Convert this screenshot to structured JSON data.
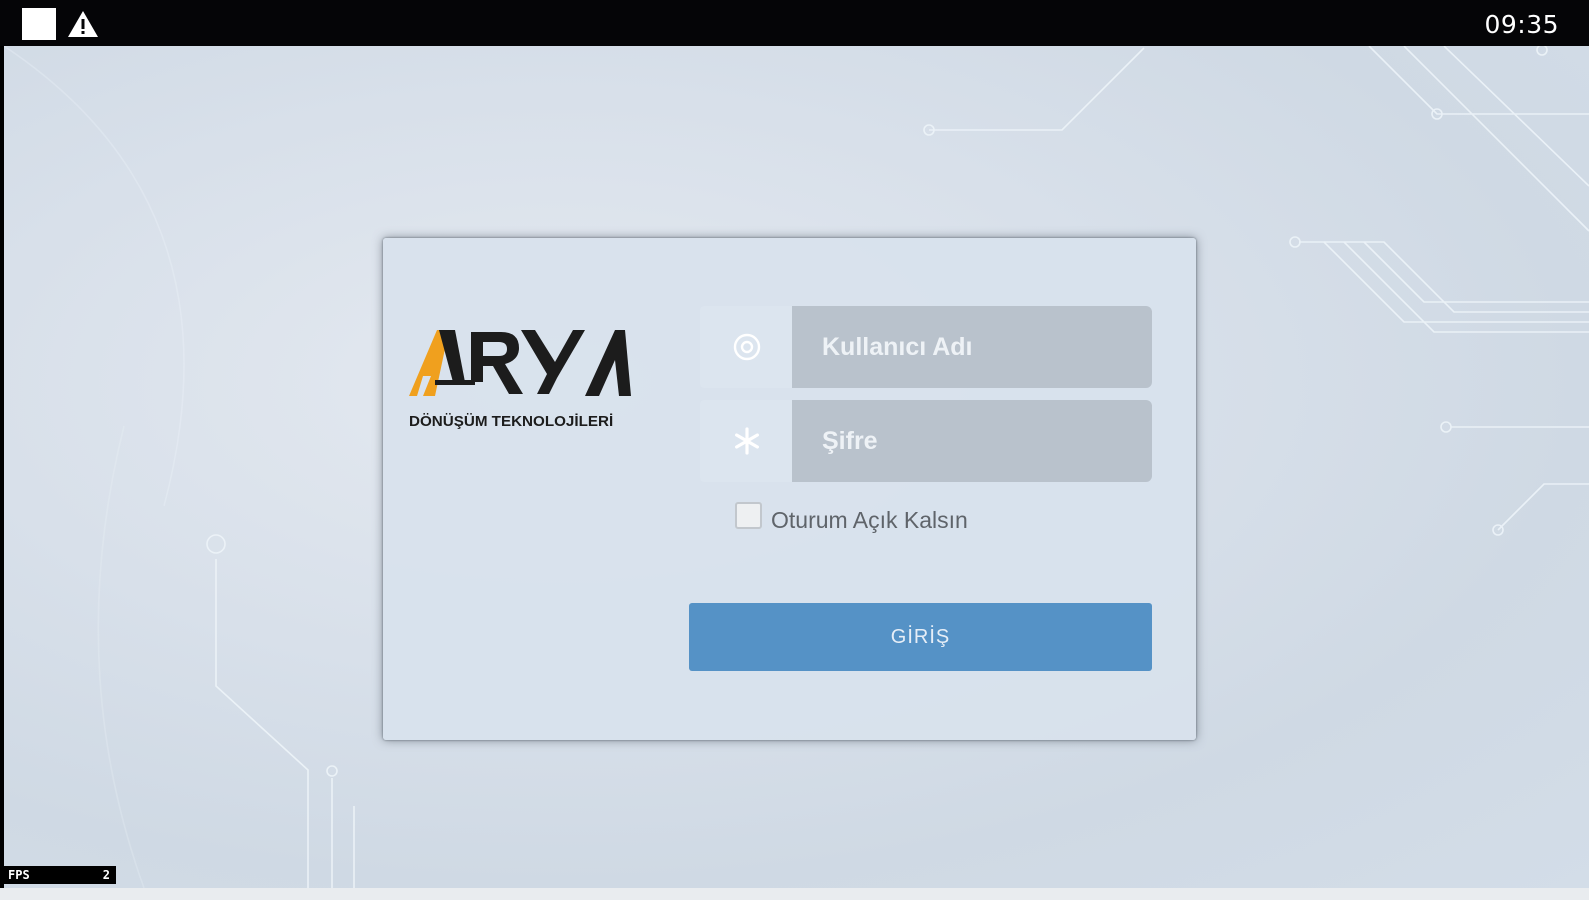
{
  "statusbar": {
    "time": "09:35",
    "icons": [
      "stop-square-icon",
      "warning-icon"
    ]
  },
  "logo": {
    "wordmark": "ARYA",
    "tagline": "DÖNÜŞÜM TEKNOLOJİLERİ",
    "accent_color": "#f0a01e",
    "dark_color": "#1c1c1c"
  },
  "login": {
    "username_placeholder": "Kullanıcı Adı",
    "username_icon": "at-icon",
    "password_placeholder": "Şifre",
    "password_icon": "asterisk-icon",
    "remember_label": "Oturum Açık Kalsın",
    "remember_checked": false,
    "submit_label": "GİRİŞ",
    "submit_color": "#5592c6"
  },
  "fps_overlay": {
    "label": "FPS",
    "value": "2"
  }
}
